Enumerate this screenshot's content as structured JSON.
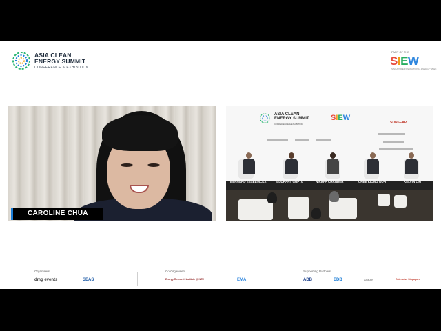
{
  "header": {
    "event_title_line1": "ASIA CLEAN",
    "event_title_line2": "ENERGY SUMMIT",
    "event_subtitle": "CONFERENCE & EXHIBITION",
    "part_of": "PART OF THE",
    "partner_logo": "SIEW",
    "partner_subtitle": "SINGAPORE INTERNATIONAL ENERGY WEEK"
  },
  "speaker": {
    "name": "CAROLINE CHUA"
  },
  "panel": {
    "backdrop_title_line1": "ASIA CLEAN",
    "backdrop_title_line2": "ENERGY SUMMIT",
    "backdrop_subtitle": "CONFERENCE & EXHIBITION",
    "backdrop_partner": "SIEW",
    "backdrop_sponsor": "SUNSEAP",
    "panelists": [
      {
        "name": "BERNARD ESSELINCKX"
      },
      {
        "name": "SIDDHANT GUPTA"
      },
      {
        "name": "NIRUPA CHANDER"
      },
      {
        "name": "CHEE KIONG GOH"
      },
      {
        "name": "KELVIN LIM"
      }
    ]
  },
  "footer": {
    "organisers_label": "Organisers",
    "organisers": [
      "dmg events",
      "SEAS"
    ],
    "co_organisers_label": "Co-Organisers",
    "co_organisers": [
      "Energy Research Institute @ NTU",
      "EMA"
    ],
    "supporting_label": "Supporting Partners",
    "supporting": [
      "ADB",
      "EDB",
      "ASEAN",
      "Enterprise Singapore"
    ]
  },
  "colors": {
    "accent_blue": "#1c7dd6",
    "siew_colors": [
      "#e84b3c",
      "#f39c12",
      "#27ae60",
      "#2e86de"
    ]
  }
}
